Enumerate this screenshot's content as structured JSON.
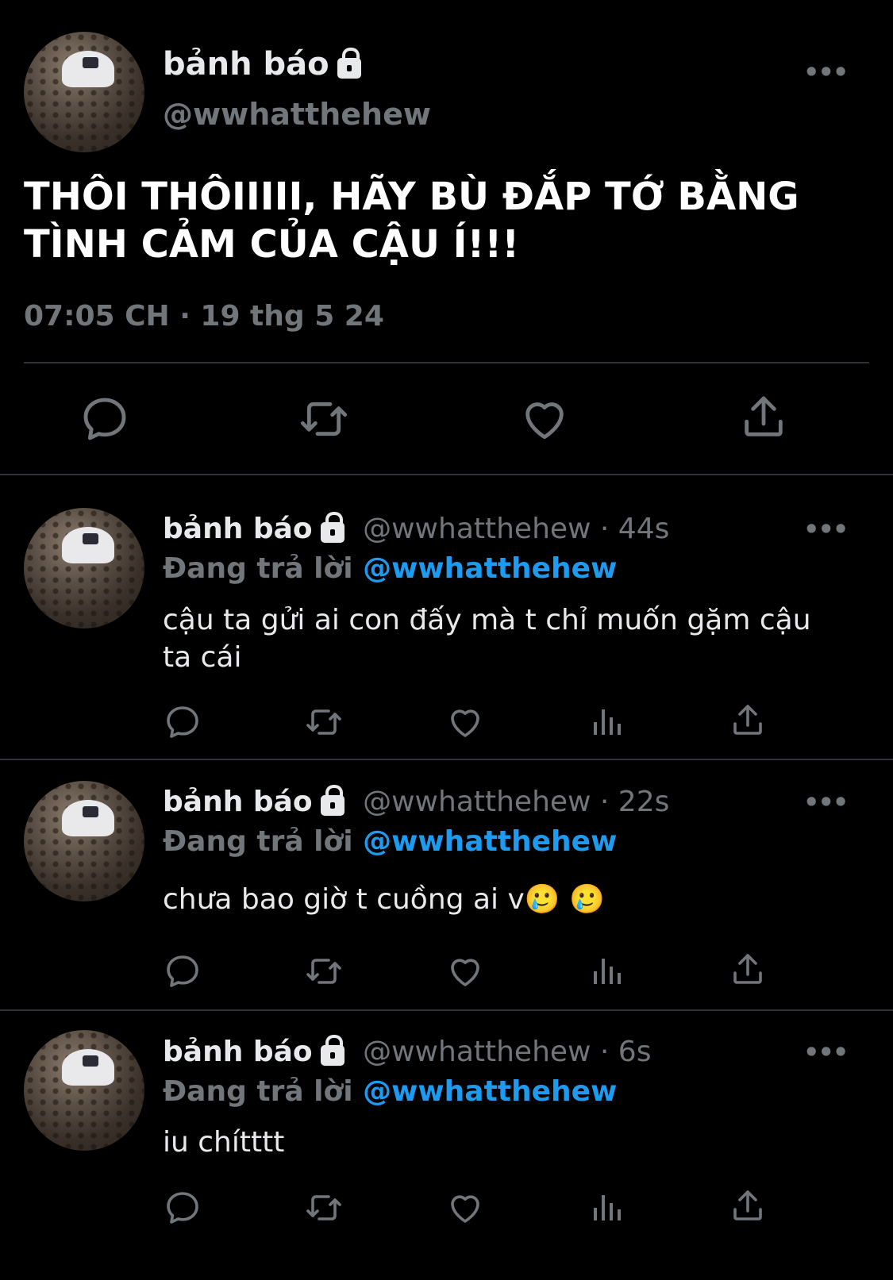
{
  "main_tweet": {
    "name": "bảnh báo",
    "handle": "@wwhatthehew",
    "text": "THÔI THÔIIIII, HÃY BÙ ĐẮP TỚ BẰNG TÌNH CẢM CỦA CẬU Í!!!",
    "timestamp": "07:05 CH · 19 thg 5 24",
    "more": "•••"
  },
  "replies": [
    {
      "name": "bảnh báo",
      "handle_time": "@wwhatthehew · 44s",
      "replying_label": "Đang trả lời",
      "replying_to": "@wwhatthehew",
      "text": "cậu ta gửi ai con đấy mà t chỉ muốn gặm cậu ta cái",
      "more": "•••"
    },
    {
      "name": "bảnh báo",
      "handle_time": "@wwhatthehew · 22s",
      "replying_label": "Đang trả lời",
      "replying_to": "@wwhatthehew",
      "text": "chưa bao giờ t cuồng ai v🥲 🥲",
      "more": "•••"
    },
    {
      "name": "bảnh báo",
      "handle_time": "@wwhatthehew · 6s",
      "replying_label": "Đang trả lời",
      "replying_to": "@wwhatthehew",
      "text": "iu chítttt",
      "more": "•••"
    }
  ],
  "colors": {
    "background": "#000000",
    "text": "#e7e9ea",
    "secondary": "#71767b",
    "accent": "#1d9bf0",
    "divider": "#2f3336"
  },
  "icons": [
    "reply-icon",
    "retweet-icon",
    "like-icon",
    "share-icon",
    "analytics-icon",
    "lock-icon",
    "more-icon"
  ]
}
